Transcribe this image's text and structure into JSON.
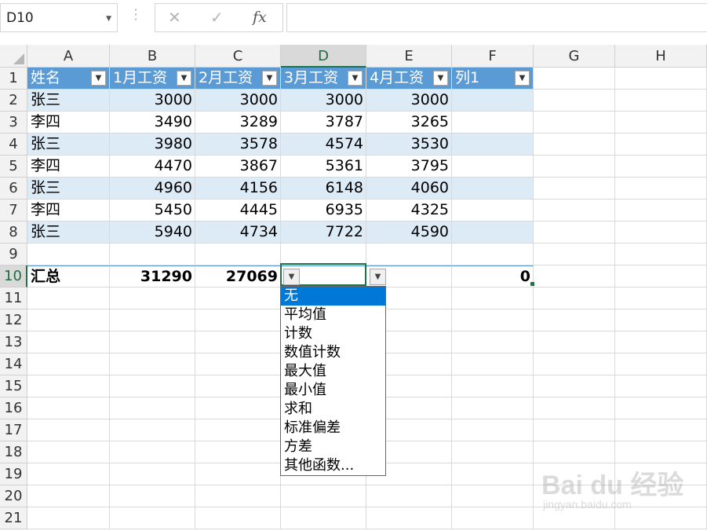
{
  "formula_bar": {
    "name_box": "D10",
    "formula": "",
    "cancel_glyph": "✕",
    "enter_glyph": "✓",
    "fx_glyph": "fx"
  },
  "columns": [
    "A",
    "B",
    "C",
    "D",
    "E",
    "F",
    "G",
    "H"
  ],
  "rows": [
    "1",
    "2",
    "3",
    "4",
    "5",
    "6",
    "7",
    "8",
    "9",
    "10",
    "11",
    "12",
    "13",
    "14",
    "15",
    "16",
    "17",
    "18",
    "19",
    "20",
    "21"
  ],
  "active_cell": "D10",
  "table": {
    "headers": [
      "姓名",
      "1月工资",
      "2月工资",
      "3月工资",
      "4月工资",
      "列1"
    ],
    "data": [
      [
        "张三",
        "3000",
        "3000",
        "3000",
        "3000",
        ""
      ],
      [
        "李四",
        "3490",
        "3289",
        "3787",
        "3265",
        ""
      ],
      [
        "张三",
        "3980",
        "3578",
        "4574",
        "3530",
        ""
      ],
      [
        "李四",
        "4470",
        "3867",
        "5361",
        "3795",
        ""
      ],
      [
        "张三",
        "4960",
        "4156",
        "6148",
        "4060",
        ""
      ],
      [
        "李四",
        "5450",
        "4445",
        "6935",
        "4325",
        ""
      ],
      [
        "张三",
        "5940",
        "4734",
        "7722",
        "4590",
        ""
      ]
    ],
    "total_row": [
      "汇总",
      "31290",
      "27069",
      "",
      "",
      "0"
    ],
    "header_color": "#5b9bd5",
    "band_color": "#ddebf7"
  },
  "dropdown": {
    "items": [
      "无",
      "平均值",
      "计数",
      "数值计数",
      "最大值",
      "最小值",
      "求和",
      "标准偏差",
      "方差",
      "其他函数..."
    ],
    "selected": "无",
    "highlight_color": "#0078d7"
  },
  "watermark": {
    "logo": "Bai du 经验",
    "sub": "jingyan.baidu.com"
  }
}
